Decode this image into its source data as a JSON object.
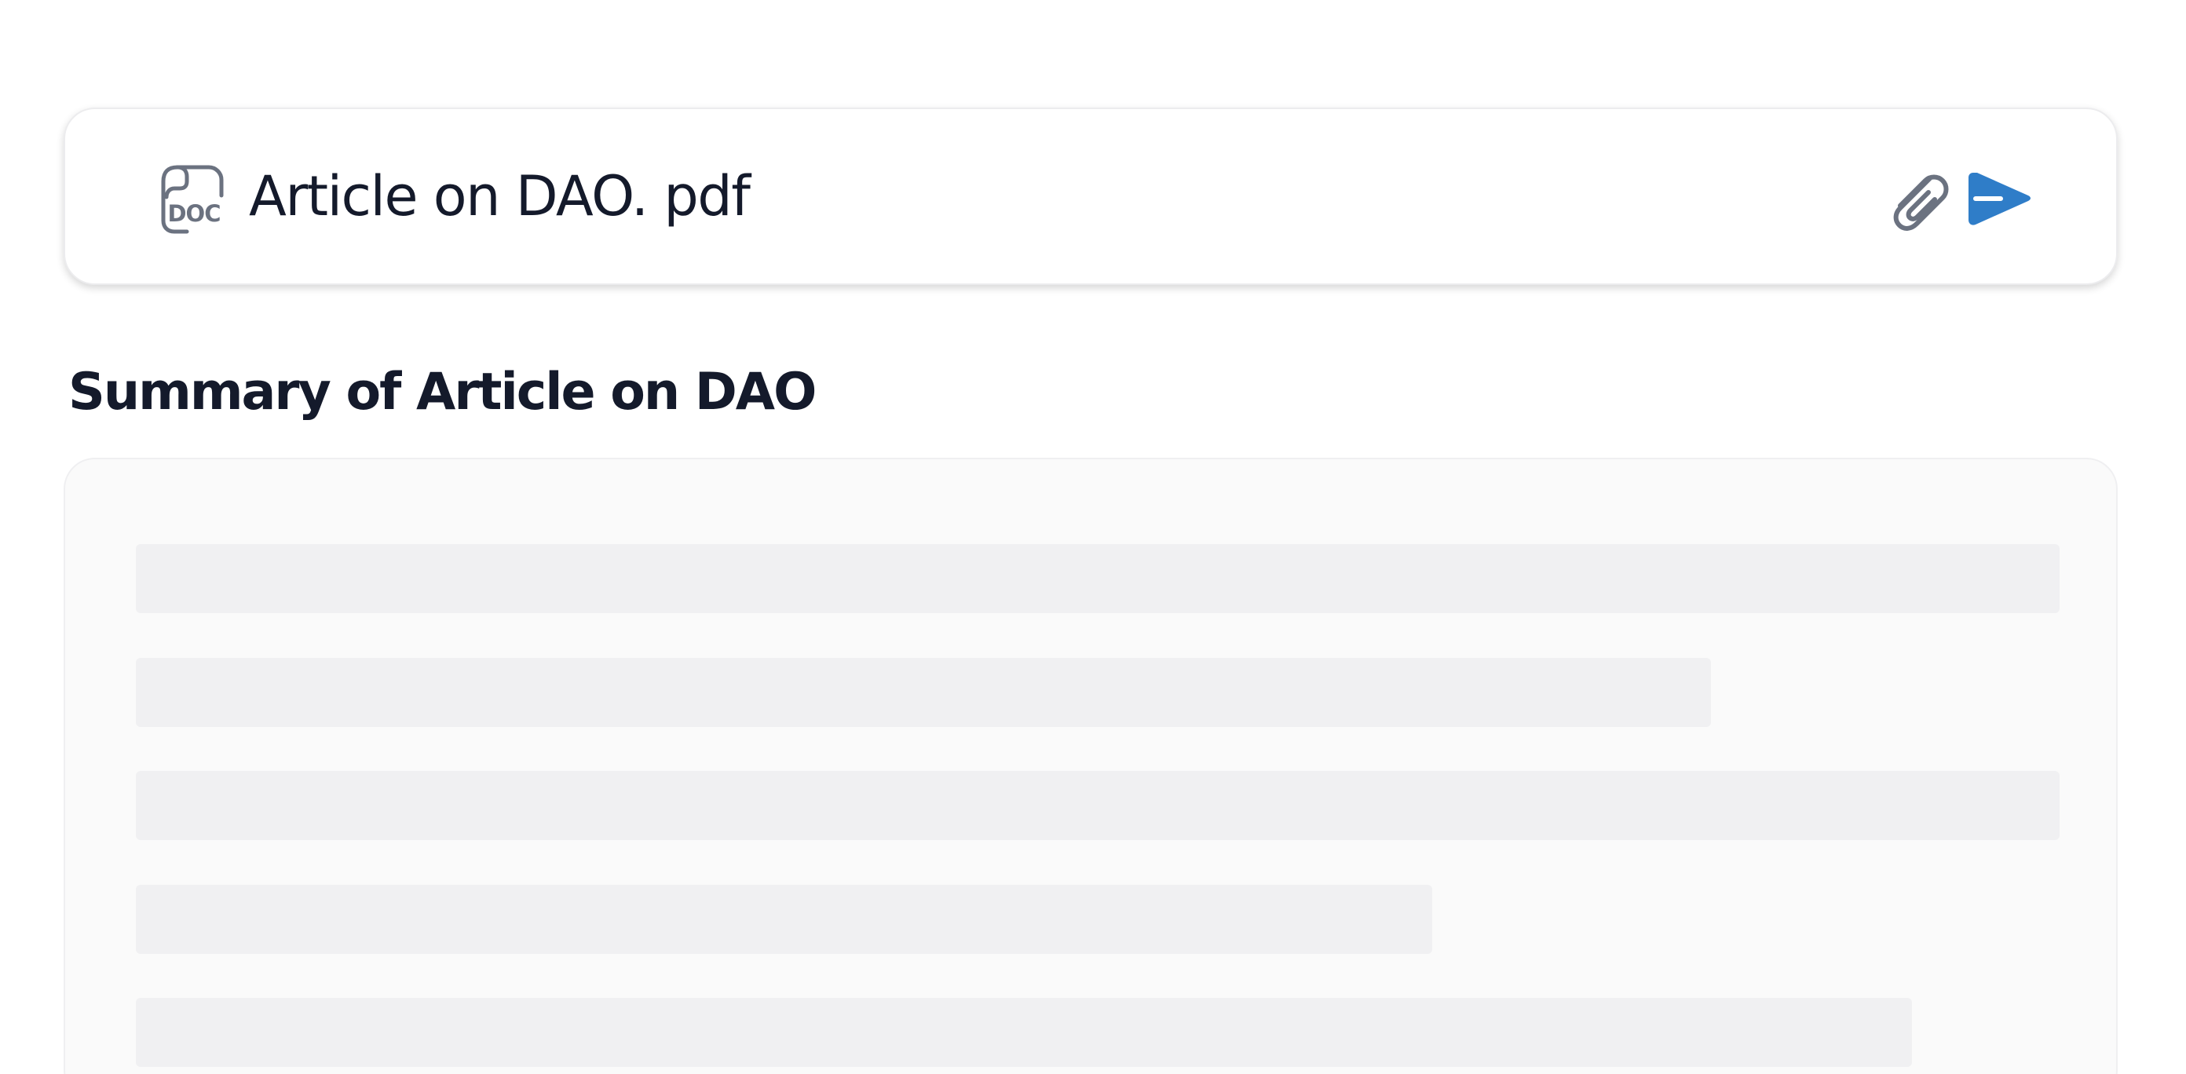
{
  "prompt": {
    "file_icon": "doc-file-icon",
    "file_name": "Article on DAO. pdf",
    "attach_icon": "paperclip-icon",
    "send_icon": "send-icon",
    "send_color": "#2f7dc8",
    "icon_color": "#6b7280"
  },
  "summary": {
    "title": "Summary of Article on DAO",
    "state": "loading",
    "skeleton_line_count": 5
  }
}
